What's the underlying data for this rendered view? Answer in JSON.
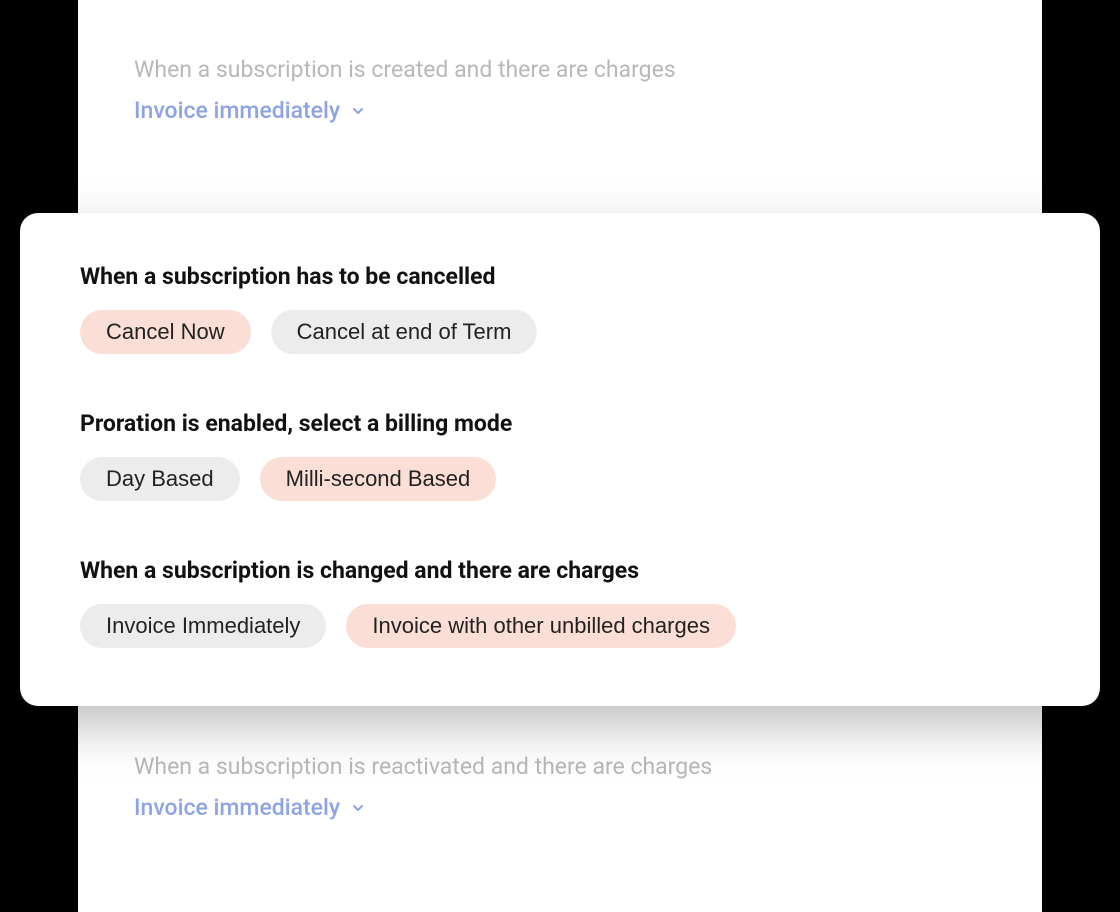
{
  "colors": {
    "accent": "#8ea3e6",
    "pill_selected_bg": "#fbdfd6",
    "pill_unselected_bg": "#ececec"
  },
  "backdrop_top": {
    "label": "When a subscription is created and there are charges",
    "dropdown_value": "Invoice immediately"
  },
  "modal": {
    "sections": [
      {
        "heading": "When a subscription has to be cancelled",
        "options": [
          {
            "label": "Cancel Now",
            "selected": true
          },
          {
            "label": "Cancel at end of Term",
            "selected": false
          }
        ]
      },
      {
        "heading": "Proration is enabled, select a billing mode",
        "options": [
          {
            "label": "Day Based",
            "selected": false
          },
          {
            "label": "Milli-second Based",
            "selected": true
          }
        ]
      },
      {
        "heading": "When a subscription is changed and there are charges",
        "options": [
          {
            "label": "Invoice Immediately",
            "selected": false
          },
          {
            "label": "Invoice with other unbilled charges",
            "selected": true
          }
        ]
      }
    ]
  },
  "backdrop_bottom": {
    "label": "When a subscription is reactivated and there are charges",
    "dropdown_value": "Invoice immediately"
  }
}
